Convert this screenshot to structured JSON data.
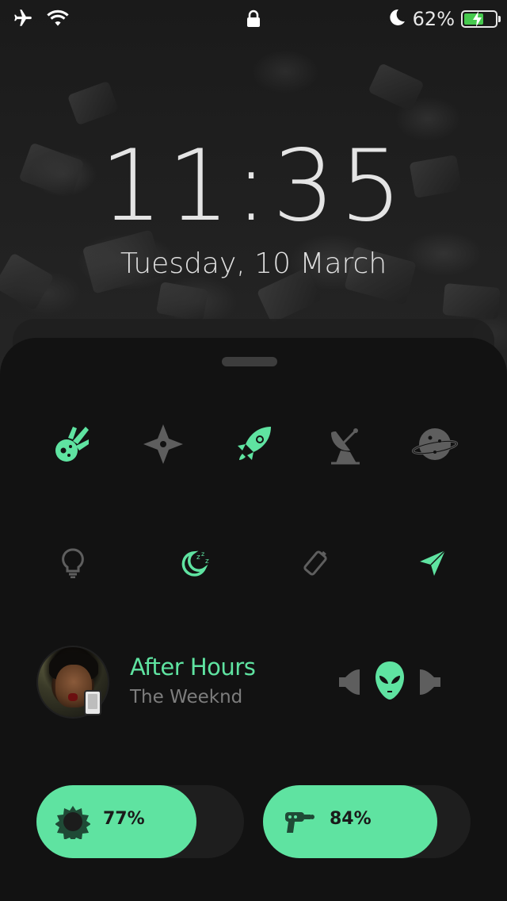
{
  "status_bar": {
    "battery_percent_text": "62%",
    "battery_level": 0.62,
    "icons": [
      "airplane-icon",
      "wifi-icon",
      "lock-icon",
      "moon-icon",
      "battery-icon"
    ]
  },
  "lock_screen": {
    "time": "11:35",
    "date": "Tuesday, 10 March"
  },
  "toggles_row1": [
    {
      "icon": "meteor-icon",
      "active": true
    },
    {
      "icon": "shuriken-icon",
      "active": false
    },
    {
      "icon": "rocket-icon",
      "active": true
    },
    {
      "icon": "satellite-dish-icon",
      "active": false
    },
    {
      "icon": "planet-icon",
      "active": false
    }
  ],
  "toggles_row2": [
    {
      "icon": "lightbulb-icon",
      "active": false
    },
    {
      "icon": "sleep-moon-icon",
      "active": true
    },
    {
      "icon": "battery-tilted-icon",
      "active": false
    },
    {
      "icon": "location-arrow-icon",
      "active": true
    }
  ],
  "now_playing": {
    "title": "After Hours",
    "artist": "The Weeknd",
    "controls": [
      "previous-icon",
      "alien-play-icon",
      "next-icon"
    ]
  },
  "sliders": [
    {
      "name": "brightness",
      "icon": "sun-icon",
      "value_text": "77%",
      "level": 0.77
    },
    {
      "name": "volume",
      "icon": "ray-gun-icon",
      "value_text": "84%",
      "level": 0.84
    }
  ],
  "colors": {
    "accent": "#5fe3a1",
    "inactive_icon": "#5e5e5e",
    "panel": "#121212",
    "battery_fill": "#46c94e"
  }
}
